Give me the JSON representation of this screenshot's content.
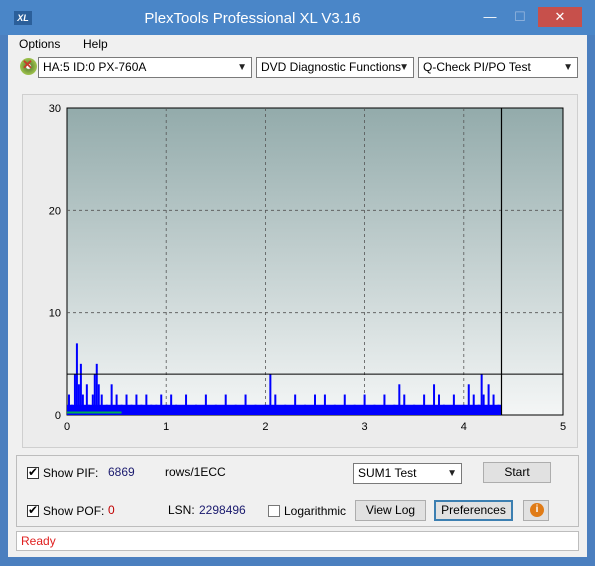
{
  "window": {
    "title": "PlexTools Professional XL V3.16",
    "app_icon_text": "XL",
    "minimize": "—",
    "maximize": "☐",
    "close": "✕"
  },
  "menu": {
    "options": "Options",
    "help": "Help"
  },
  "toolbar": {
    "drive": "HA:5 ID:0  PX-760A",
    "function": "DVD Diagnostic Functions",
    "test": "Q-Check PI/PO Test"
  },
  "chart_data": {
    "type": "bar",
    "x_ticks": [
      "0",
      "1",
      "2",
      "3",
      "4",
      "5"
    ],
    "y_ticks": [
      "0",
      "10",
      "20",
      "30"
    ],
    "xlim": [
      0,
      5
    ],
    "ylim": [
      0,
      30
    ],
    "grid": true,
    "threshold_line": 4,
    "end_marker_x": 4.38,
    "series": [
      {
        "color": "#0000ff",
        "points": [
          [
            0.02,
            2
          ],
          [
            0.05,
            1
          ],
          [
            0.08,
            4
          ],
          [
            0.1,
            7
          ],
          [
            0.12,
            3
          ],
          [
            0.14,
            5
          ],
          [
            0.16,
            2
          ],
          [
            0.2,
            3
          ],
          [
            0.22,
            1
          ],
          [
            0.26,
            2
          ],
          [
            0.28,
            4
          ],
          [
            0.3,
            5
          ],
          [
            0.32,
            3
          ],
          [
            0.35,
            2
          ],
          [
            0.4,
            1
          ],
          [
            0.45,
            3
          ],
          [
            0.5,
            2
          ],
          [
            0.55,
            1
          ],
          [
            0.6,
            2
          ],
          [
            0.65,
            1
          ],
          [
            0.7,
            2
          ],
          [
            0.75,
            1
          ],
          [
            0.8,
            2
          ],
          [
            0.85,
            1
          ],
          [
            0.9,
            1
          ],
          [
            0.95,
            2
          ],
          [
            1.0,
            1
          ],
          [
            1.05,
            2
          ],
          [
            1.1,
            1
          ],
          [
            1.2,
            2
          ],
          [
            1.3,
            1
          ],
          [
            1.4,
            2
          ],
          [
            1.5,
            1
          ],
          [
            1.6,
            2
          ],
          [
            1.7,
            1
          ],
          [
            1.8,
            2
          ],
          [
            1.9,
            1
          ],
          [
            2.0,
            1
          ],
          [
            2.05,
            4
          ],
          [
            2.1,
            2
          ],
          [
            2.2,
            1
          ],
          [
            2.3,
            2
          ],
          [
            2.4,
            1
          ],
          [
            2.5,
            2
          ],
          [
            2.6,
            2
          ],
          [
            2.7,
            1
          ],
          [
            2.8,
            2
          ],
          [
            2.9,
            1
          ],
          [
            3.0,
            2
          ],
          [
            3.1,
            1
          ],
          [
            3.2,
            2
          ],
          [
            3.3,
            1
          ],
          [
            3.35,
            3
          ],
          [
            3.4,
            2
          ],
          [
            3.5,
            1
          ],
          [
            3.6,
            2
          ],
          [
            3.7,
            3
          ],
          [
            3.75,
            2
          ],
          [
            3.8,
            1
          ],
          [
            3.9,
            2
          ],
          [
            4.0,
            1
          ],
          [
            4.05,
            3
          ],
          [
            4.1,
            2
          ],
          [
            4.15,
            1
          ],
          [
            4.18,
            4
          ],
          [
            4.2,
            2
          ],
          [
            4.25,
            3
          ],
          [
            4.3,
            2
          ],
          [
            4.35,
            1
          ]
        ]
      },
      {
        "color": "#00b050",
        "level": 0.25
      }
    ]
  },
  "controls": {
    "show_pif_label": "Show PIF:",
    "pif_value": "6869",
    "rows_label": "rows/1ECC",
    "show_pof_label": "Show POF:",
    "pof_value": "0",
    "lsn_label": "LSN:",
    "lsn_value": "2298496",
    "logarithmic_label": "Logarithmic",
    "sum_select": "SUM1 Test",
    "start": "Start",
    "view_log": "View Log",
    "preferences": "Preferences",
    "info": "i",
    "check_mark": "✔"
  },
  "status": {
    "text": "Ready"
  }
}
